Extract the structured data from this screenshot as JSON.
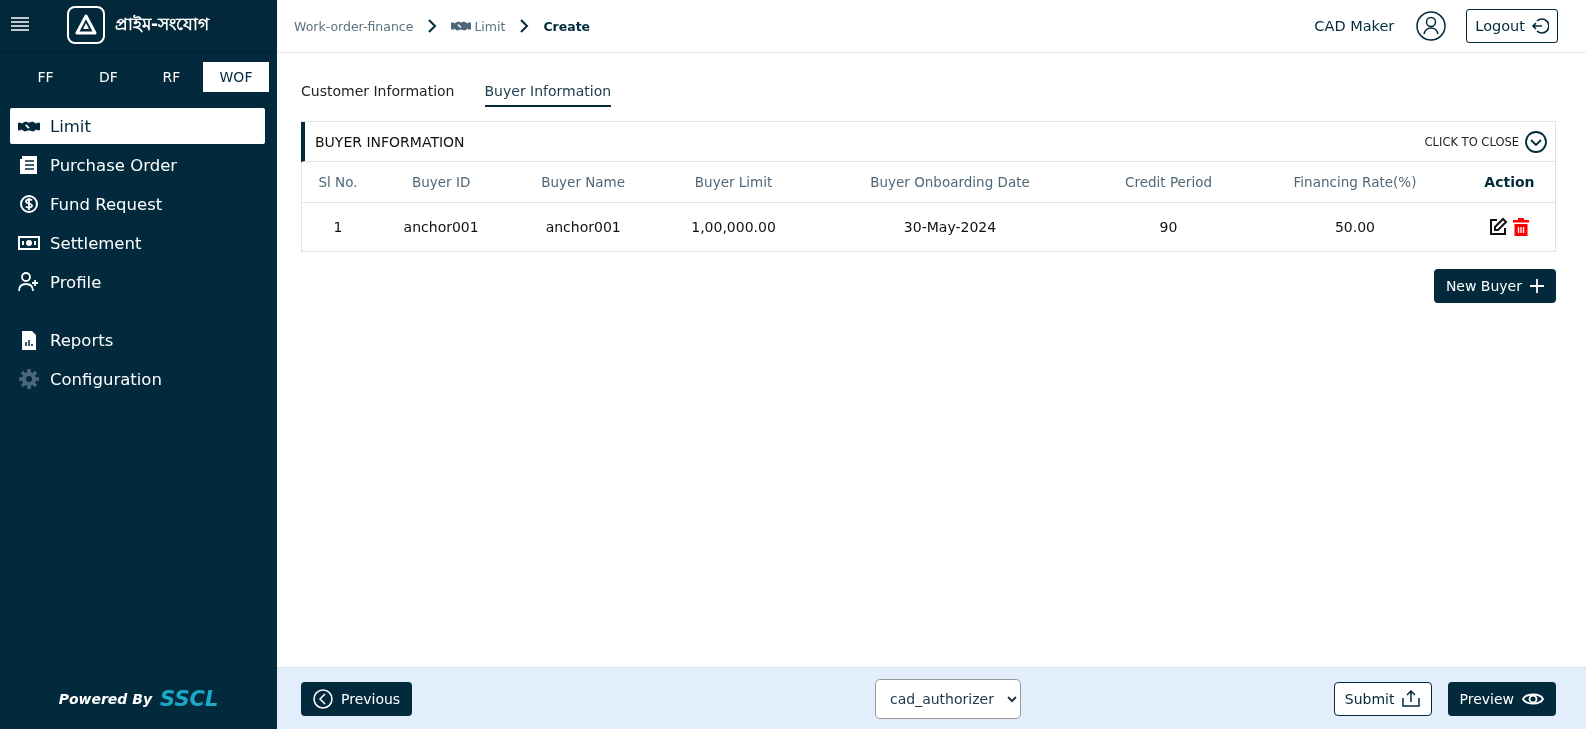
{
  "sidebar": {
    "brand": "প্রাইম-সংযোগ",
    "modules": [
      {
        "label": "FF",
        "selected": false
      },
      {
        "label": "DF",
        "selected": false
      },
      {
        "label": "RF",
        "selected": false
      },
      {
        "label": "WOF",
        "selected": true
      }
    ],
    "sections": [
      [
        {
          "label": "Limit",
          "selected": true
        },
        {
          "label": "Purchase Order",
          "selected": false
        },
        {
          "label": "Fund Request",
          "selected": false
        },
        {
          "label": "Settlement",
          "selected": false
        },
        {
          "label": "Profile",
          "selected": false
        }
      ],
      [
        {
          "label": "Reports",
          "selected": false
        },
        {
          "label": "Configuration",
          "selected": false
        }
      ]
    ],
    "footer": {
      "prefix": "Powered By",
      "brand": "SSCL"
    }
  },
  "header": {
    "breadcrumb": [
      "Work-order-finance",
      "Limit",
      "Create"
    ],
    "user": "CAD Maker",
    "logout": "Logout"
  },
  "tabs": [
    {
      "label": "Customer Information",
      "selected": false
    },
    {
      "label": "Buyer Information",
      "selected": true
    }
  ],
  "panel": {
    "title": "BUYER INFORMATION",
    "toggle": "CLICK TO CLOSE",
    "table": {
      "columns": [
        "Sl No.",
        "Buyer ID",
        "Buyer Name",
        "Buyer Limit",
        "Buyer Onboarding Date",
        "Credit Period",
        "Financing Rate(%)",
        "Action"
      ],
      "rows": [
        [
          "1",
          "anchor001",
          "anchor001",
          "1,00,000.00",
          "30-May-2024",
          "90",
          "50.00"
        ]
      ]
    }
  },
  "new_button": "New Buyer",
  "footer": {
    "previous": "Previous",
    "role": {
      "value": "cad_authorizer"
    },
    "submit": "Submit",
    "preview": "Preview"
  }
}
